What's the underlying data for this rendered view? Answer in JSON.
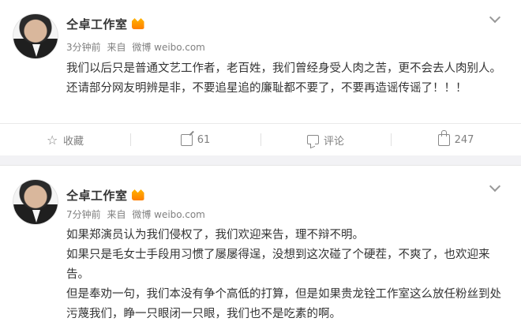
{
  "posts": [
    {
      "author": "仝卓工作室",
      "time": "3分钟前",
      "source_prefix": "来自",
      "source": "微博 weibo.com",
      "paragraphs": [
        "我们以后只是普通文艺工作者，老百姓，我们曾经身受人肉之苦，更不会去人肉别人。还请部分网友明辨是非，不要追星追的廉耻都不要了，不要再造谣传谣了！！！"
      ],
      "actions": {
        "favorite": "收藏",
        "repost": "61",
        "comment": "评论",
        "like": "247"
      }
    },
    {
      "author": "仝卓工作室",
      "time": "7分钟前",
      "source_prefix": "来自",
      "source": "微博 weibo.com",
      "paragraphs": [
        "如果郑演员认为我们侵权了，我们欢迎来告，理不辩不明。",
        "如果只是毛女士手段用习惯了屡屡得逞，没想到这次碰了个硬茬，不爽了，也欢迎来告。",
        "但是奉劝一句，我们本没有争个高低的打算，但是如果贵龙铨工作室这么放任粉丝到处污蔑我们，睁一只眼闭一只眼，我们也不是吃素的啊。"
      ]
    }
  ],
  "colors": {
    "background": "#f2f2f5",
    "card": "#ffffff",
    "text": "#333333",
    "meta": "#808080",
    "vip_badge": "#ff9a00"
  },
  "icons": [
    "more-chevron-icon",
    "star-icon",
    "repost-icon",
    "comment-icon",
    "like-icon",
    "vip-badge-icon"
  ]
}
